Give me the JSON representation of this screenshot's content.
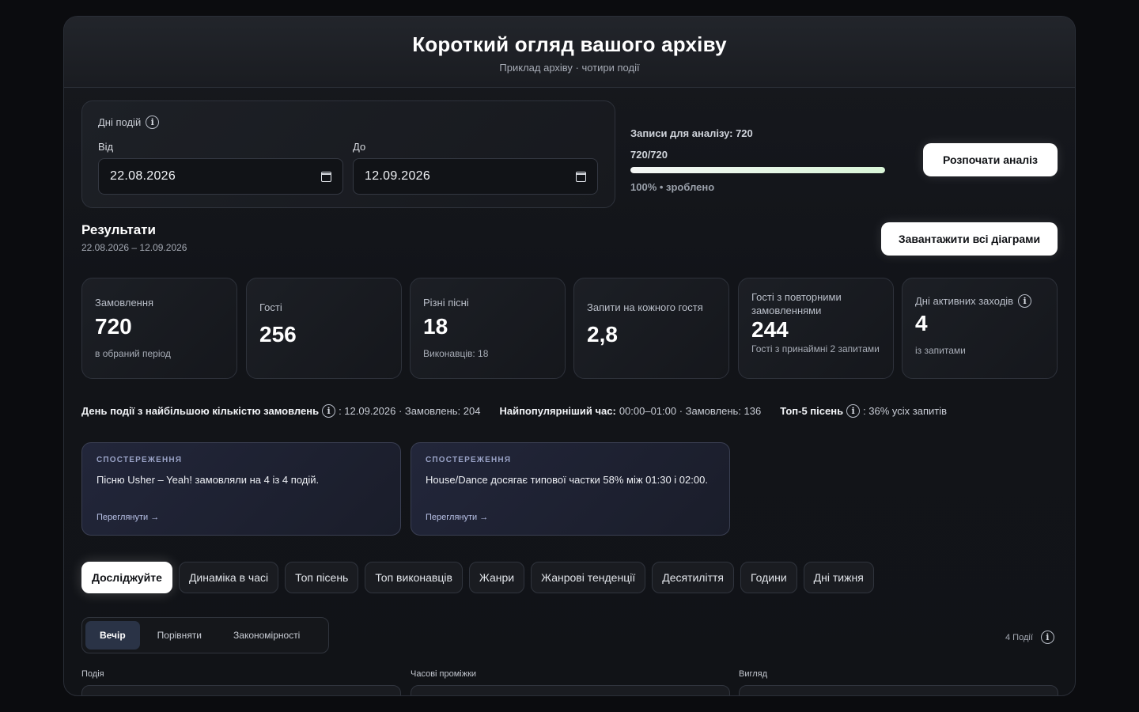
{
  "header": {
    "title": "Короткий огляд вашого архіву",
    "subtitle": "Приклад архіву · чотири події"
  },
  "dates": {
    "label": "Дні подій",
    "from_label": "Від",
    "from_value": "22.08.2026",
    "to_label": "До",
    "to_value": "12.09.2026"
  },
  "analysis": {
    "records_label": "Записи для аналізу: 720",
    "count": "720/720",
    "progress": 1.0,
    "status": "100%  •  зроблено",
    "start_button": "Розпочати аналіз"
  },
  "results": {
    "title": "Результати",
    "range": "22.08.2026 – 12.09.2026",
    "download_button": "Завантажити всі діаграми"
  },
  "kpis": [
    {
      "label": "Замовлення",
      "value": "720",
      "note": "в обраний період"
    },
    {
      "label": "Гості",
      "value": "256",
      "note": ""
    },
    {
      "label": "Різні пісні",
      "value": "18",
      "note": "Виконавців: 18"
    },
    {
      "label": "Запити на кожного гостя",
      "value": "2,8",
      "note": ""
    },
    {
      "label": "Гості з повторними замовленнями",
      "value": "244",
      "note": "Гості з принаймні 2 запитами"
    },
    {
      "label": "Дні активних заходів",
      "value": "4",
      "note": "із запитами"
    }
  ],
  "facts": {
    "peak_day_label": "День події з найбільшою кількістю замовлень",
    "peak_day_value": ": 12.09.2026 · Замовлень: 204",
    "peak_hour_label": "Найпопулярніший час:",
    "peak_hour_value": "00:00–01:00 · Замовлень: 136",
    "top5_label": "Топ-5 пісень",
    "top5_value": ": 36% усіх запитів"
  },
  "observations": [
    {
      "tag": "СПОСТЕРЕЖЕННЯ",
      "text": "Пісню Usher – Yeah! замовляли на 4 із 4 подій.",
      "link": "Переглянути →"
    },
    {
      "tag": "СПОСТЕРЕЖЕННЯ",
      "text": "House/Dance досягає типової частки 58% між 01:30 і 02:00.",
      "link": "Переглянути →"
    }
  ],
  "tabs": [
    "Досліджуйте",
    "Динаміка в часі",
    "Топ пісень",
    "Топ виконавців",
    "Жанри",
    "Жанрові тенденції",
    "Десятиліття",
    "Години",
    "Дні тижня"
  ],
  "segments": [
    "Вечір",
    "Порівняти",
    "Закономірності"
  ],
  "events_count": "4 Події",
  "bottom": {
    "event_label": "Подія",
    "intervals_label": "Часові проміжки",
    "view_label": "Вигляд"
  }
}
